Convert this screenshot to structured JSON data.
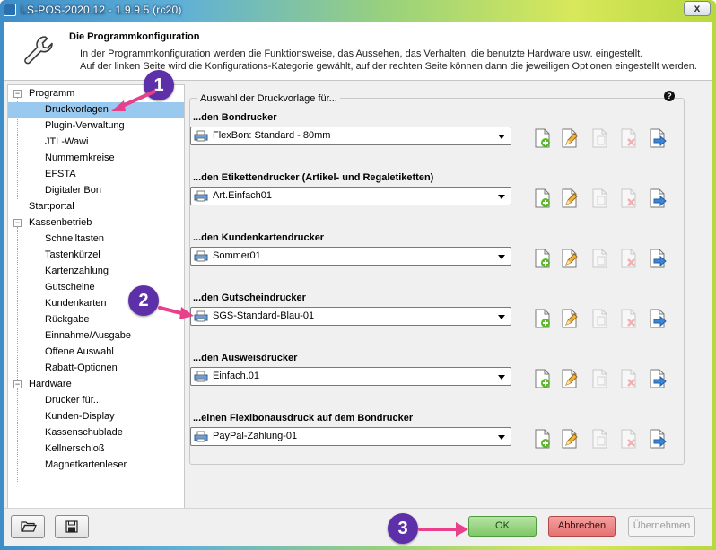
{
  "window": {
    "title": "LS-POS-2020.12 - 1.9.9.5 (rc20)",
    "close_label": "x"
  },
  "header": {
    "title": "Die Programmkonfiguration",
    "line1": "In der Programmkonfiguration werden die Funktionsweise, das Aussehen, das Verhalten, die benutzte Hardware usw. eingestellt.",
    "line2": "Auf der linken Seite wird die Konfigurations-Kategorie gewählt, auf der rechten Seite können dann die jeweiligen Optionen eingestellt werden."
  },
  "tree": {
    "items": [
      {
        "label": "Programm",
        "level": 0,
        "expander": "−"
      },
      {
        "label": "Druckvorlagen",
        "level": 1,
        "selected": true
      },
      {
        "label": "Plugin-Verwaltung",
        "level": 1
      },
      {
        "label": "JTL-Wawi",
        "level": 1
      },
      {
        "label": "Nummernkreise",
        "level": 1
      },
      {
        "label": "EFSTA",
        "level": 1
      },
      {
        "label": "Digitaler Bon",
        "level": 1
      },
      {
        "label": "Startportal",
        "level": 0
      },
      {
        "label": "Kassenbetrieb",
        "level": 0,
        "expander": "−"
      },
      {
        "label": "Schnelltasten",
        "level": 1
      },
      {
        "label": "Tastenkürzel",
        "level": 1
      },
      {
        "label": "Kartenzahlung",
        "level": 1
      },
      {
        "label": "Gutscheine",
        "level": 1
      },
      {
        "label": "Kundenkarten",
        "level": 1
      },
      {
        "label": "Rückgabe",
        "level": 1
      },
      {
        "label": "Einnahme/Ausgabe",
        "level": 1
      },
      {
        "label": "Offene Auswahl",
        "level": 1
      },
      {
        "label": "Rabatt-Optionen",
        "level": 1
      },
      {
        "label": "Hardware",
        "level": 0,
        "expander": "−"
      },
      {
        "label": "Drucker für...",
        "level": 1
      },
      {
        "label": "Kunden-Display",
        "level": 1
      },
      {
        "label": "Kassenschublade",
        "level": 1
      },
      {
        "label": "Kellnerschloß",
        "level": 1
      },
      {
        "label": "Magnetkartenleser",
        "level": 1
      }
    ]
  },
  "panel": {
    "caption": "Auswahl der Druckvorlage für...",
    "help": "?",
    "groups": [
      {
        "label": "...den Bondrucker",
        "value": "FlexBon: Standard - 80mm"
      },
      {
        "label": "...den Etikettendrucker (Artikel- und Regaletiketten)",
        "value": "Art.Einfach01"
      },
      {
        "label": "...den Kundenkartendrucker",
        "value": "Sommer01"
      },
      {
        "label": "...den Gutscheindrucker",
        "value": "SGS-Standard-Blau-01"
      },
      {
        "label": "...den Ausweisdrucker",
        "value": "Einfach.01"
      },
      {
        "label": "...einen Flexibonausdruck auf dem Bondrucker",
        "value": "PayPal-Zahlung-01"
      }
    ]
  },
  "buttons": {
    "ok": "OK",
    "cancel": "Abbrechen",
    "apply": "Übernehmen"
  },
  "annotations": {
    "badge1": "1",
    "badge2": "2",
    "badge3": "3"
  },
  "colors": {
    "badge": "#5d2fa8",
    "arrow": "#e8408a",
    "selection": "#99c9ef"
  }
}
